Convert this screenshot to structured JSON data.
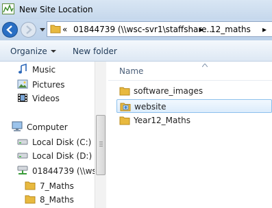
{
  "window": {
    "title": "New Site Location"
  },
  "navigation": {
    "address_overflow": "«",
    "breadcrumb": [
      "01844739 (\\\\wsc-svr1\\staffshare...",
      "12_maths"
    ],
    "separator": "▸"
  },
  "toolbar": {
    "organize_label": "Organize",
    "new_folder_label": "New folder"
  },
  "sidebar": {
    "items": [
      {
        "label": "Music",
        "icon": "music-icon"
      },
      {
        "label": "Pictures",
        "icon": "pictures-icon"
      },
      {
        "label": "Videos",
        "icon": "videos-icon"
      },
      {
        "label": "Computer",
        "icon": "computer-icon"
      },
      {
        "label": "Local Disk (C:)",
        "icon": "hard-drive-icon"
      },
      {
        "label": "Local Disk (D:)",
        "icon": "hard-drive-icon"
      },
      {
        "label": "01844739 (\\\\wsc-",
        "icon": "network-drive-icon"
      },
      {
        "label": "7_Maths",
        "icon": "folder-icon"
      },
      {
        "label": "8_Maths",
        "icon": "folder-icon"
      }
    ]
  },
  "file_list": {
    "column_header": "Name",
    "items": [
      {
        "name": "software_images",
        "icon": "folder-icon",
        "selected": false
      },
      {
        "name": "website",
        "icon": "web-folder-icon",
        "selected": true
      },
      {
        "name": "Year12_Maths",
        "icon": "folder-icon",
        "selected": false
      }
    ]
  },
  "colors": {
    "selection": "#cde8ff",
    "title_bar": "#c6d8ec",
    "folder": "#e8b93f"
  }
}
